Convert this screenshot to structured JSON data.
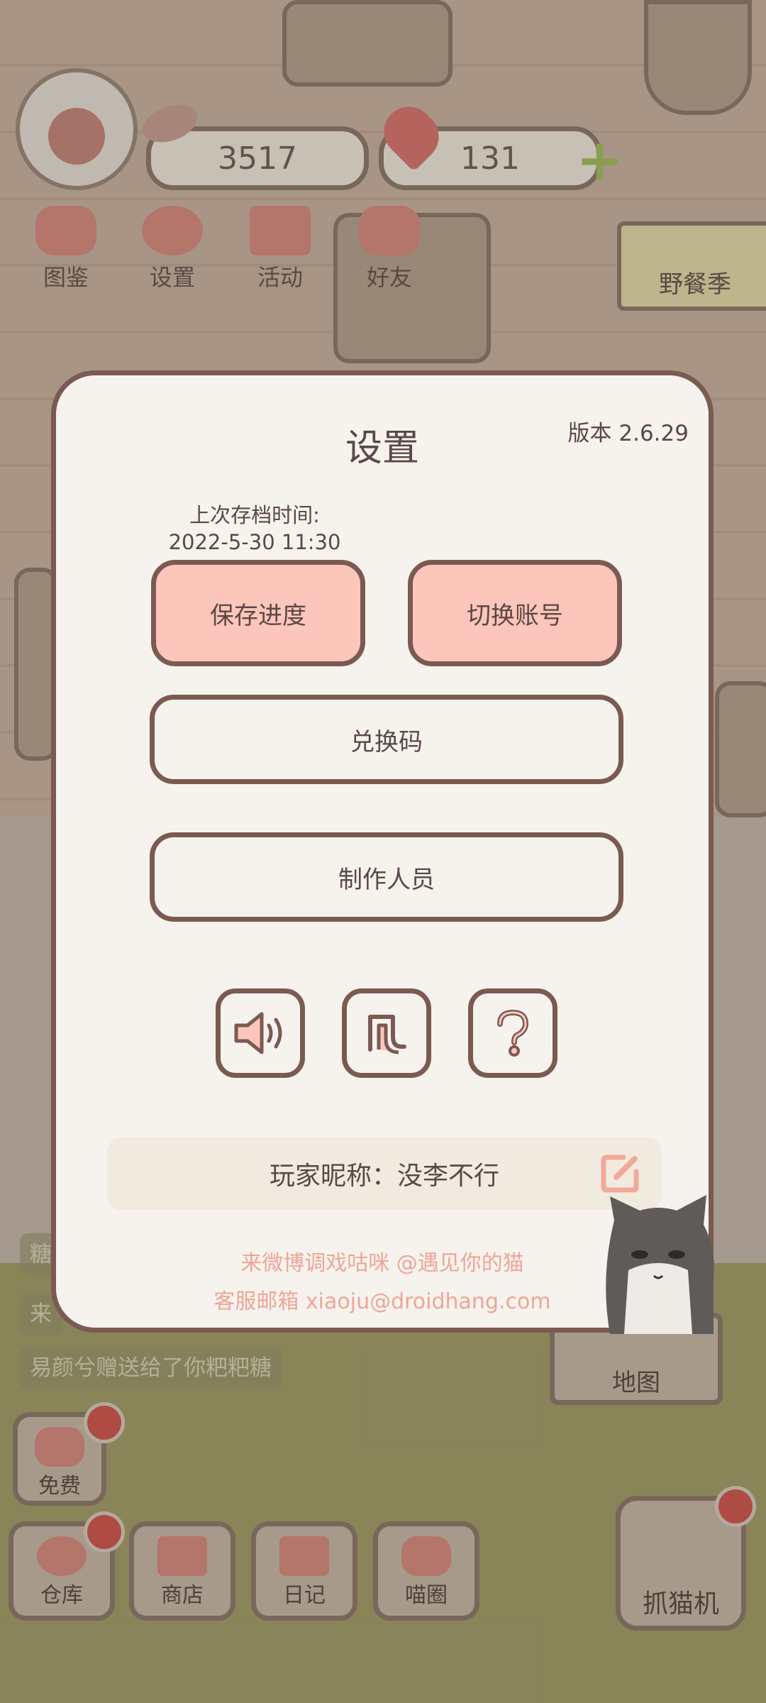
{
  "hud": {
    "coins": "3517",
    "hearts": "131",
    "menu": [
      {
        "label": "图鉴"
      },
      {
        "label": "设置"
      },
      {
        "label": "活动"
      },
      {
        "label": "好友"
      }
    ],
    "season_label": "野餐季"
  },
  "settings": {
    "title": "设置",
    "version": "版本 2.6.29",
    "last_save_label": "上次存档时间:",
    "last_save_time": "2022-5-30 11:30",
    "save_button": "保存进度",
    "switch_account_button": "切换账号",
    "redeem_code_button": "兑换码",
    "credits_button": "制作人员",
    "icon_buttons": [
      "sound-icon",
      "music-icon",
      "help-icon"
    ],
    "nickname_label": "玩家昵称：没李不行",
    "weibo_text": "来微博调戏咕咪 @遇见你的猫",
    "email_text": "客服邮箱 xiaoju@droidhang.com"
  },
  "chat": [
    {
      "text": "糖"
    },
    {
      "text": "来"
    },
    {
      "text": "易颜兮赠送给了你粑粑糖"
    }
  ],
  "bottom": {
    "map_label": "地图",
    "free_label": "免费",
    "nav": [
      {
        "label": "仓库"
      },
      {
        "label": "商店"
      },
      {
        "label": "日记"
      },
      {
        "label": "喵圈"
      }
    ],
    "claw_label": "抓猫机"
  },
  "colors": {
    "dialog_bg": "#f6f3ee",
    "dialog_border": "#7b5a52",
    "pink_button": "#fcc6bb",
    "contact_text": "#efa696",
    "badge_red": "#c0403a"
  }
}
